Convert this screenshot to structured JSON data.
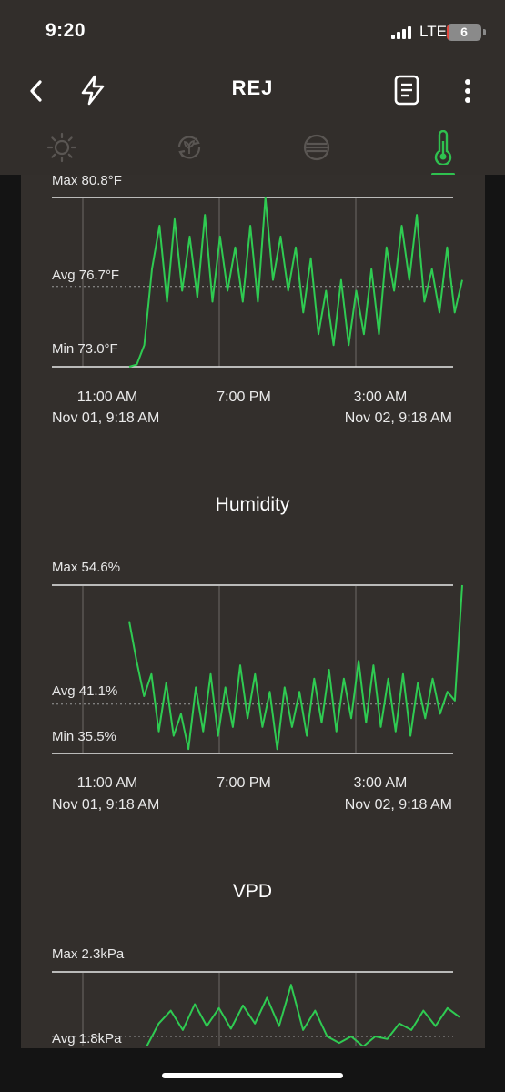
{
  "status_bar": {
    "time": "9:20",
    "network": "LTE",
    "battery": "6",
    "battery_level_percent": 6
  },
  "nav": {
    "title": "REJ",
    "back_icon": "chevron-left-icon",
    "lightning_icon": "lightning-icon",
    "report_icon": "document-icon",
    "more_icon": "more-vertical-icon",
    "tabs": [
      {
        "icon": "sun-icon",
        "active": false
      },
      {
        "icon": "plant-cycle-icon",
        "active": false
      },
      {
        "icon": "layers-icon",
        "active": false
      },
      {
        "icon": "thermometer-icon",
        "active": true
      }
    ],
    "accent_color": "#2fc14f"
  },
  "colors": {
    "line": "#2fcb52",
    "background": "#332f2c",
    "text": "#ffffff"
  },
  "charts": [
    {
      "title": "",
      "max_label": "Max 80.8°F",
      "avg_label": "Avg 76.7°F",
      "min_label": "Min 73.0°F",
      "time_labels": [
        "11:00 AM",
        "7:00 PM",
        "3:00 AM"
      ],
      "start_date": "Nov 01, 9:18 AM",
      "end_date": "Nov 02, 9:18 AM"
    },
    {
      "title": "Humidity",
      "max_label": "Max 54.6%",
      "avg_label": "Avg 41.1%",
      "min_label": "Min 35.5%",
      "time_labels": [
        "11:00 AM",
        "7:00 PM",
        "3:00 AM"
      ],
      "start_date": "Nov 01, 9:18 AM",
      "end_date": "Nov 02, 9:18 AM"
    },
    {
      "title": "VPD",
      "max_label": "Max 2.3kPa",
      "avg_label": "Avg 1.8kPa"
    }
  ],
  "chart_data": [
    {
      "type": "line",
      "title": "",
      "ylabel": "°F",
      "ylim": [
        73.0,
        80.8
      ],
      "x": [
        "Nov 01, 9:18 AM",
        "11:00 AM",
        "7:00 PM",
        "3:00 AM",
        "Nov 02, 9:18 AM"
      ],
      "series": [
        {
          "values": [
            73.0,
            73.1,
            74.0,
            77.5,
            79.5,
            76.0,
            79.8,
            76.5,
            79.0,
            76.2,
            80.0,
            76.0,
            79.0,
            76.5,
            78.5,
            76.0,
            79.5,
            76.0,
            80.8,
            77.0,
            79.0,
            76.5,
            78.5,
            75.5,
            78.0,
            74.5,
            76.5,
            74.0,
            77.0,
            74.0,
            76.5,
            74.5,
            77.5,
            74.5,
            78.5,
            76.5,
            79.5,
            77.0,
            80.0,
            76.0,
            77.5,
            75.5,
            78.5,
            75.5,
            77.0
          ]
        }
      ]
    },
    {
      "type": "line",
      "title": "Humidity",
      "ylabel": "%",
      "ylim": [
        35.5,
        54.6
      ],
      "x": [
        "Nov 01, 9:18 AM",
        "11:00 AM",
        "7:00 PM",
        "3:00 AM",
        "Nov 02, 9:18 AM"
      ],
      "series": [
        {
          "values": [
            50.5,
            46.0,
            42.0,
            44.5,
            38.0,
            43.5,
            37.5,
            40.0,
            36.0,
            43.0,
            38.0,
            44.5,
            37.5,
            43.0,
            38.5,
            45.5,
            39.5,
            44.5,
            38.5,
            42.5,
            36.0,
            43.0,
            38.5,
            42.5,
            37.5,
            44.0,
            39.0,
            45.0,
            38.0,
            44.0,
            39.5,
            46.0,
            39.0,
            45.5,
            38.5,
            44.0,
            38.0,
            44.5,
            37.5,
            43.5,
            39.5,
            44.0,
            40.0,
            42.5,
            41.5,
            54.6
          ]
        }
      ]
    },
    {
      "type": "line",
      "title": "VPD",
      "ylabel": "kPa",
      "ylim": [
        1.3,
        2.3
      ],
      "x": [
        "Nov 01, 9:18 AM",
        "11:00 AM",
        "7:00 PM",
        "3:00 AM"
      ],
      "series": [
        {
          "values": [
            1.7,
            1.72,
            1.9,
            2.0,
            1.85,
            2.05,
            1.88,
            2.02,
            1.86,
            2.04,
            1.9,
            2.1,
            1.88,
            2.2,
            1.85,
            2.0,
            1.8,
            1.75,
            1.8,
            1.7,
            1.8,
            1.78,
            1.9,
            1.85,
            2.0,
            1.88,
            2.02,
            1.95
          ]
        }
      ]
    }
  ]
}
